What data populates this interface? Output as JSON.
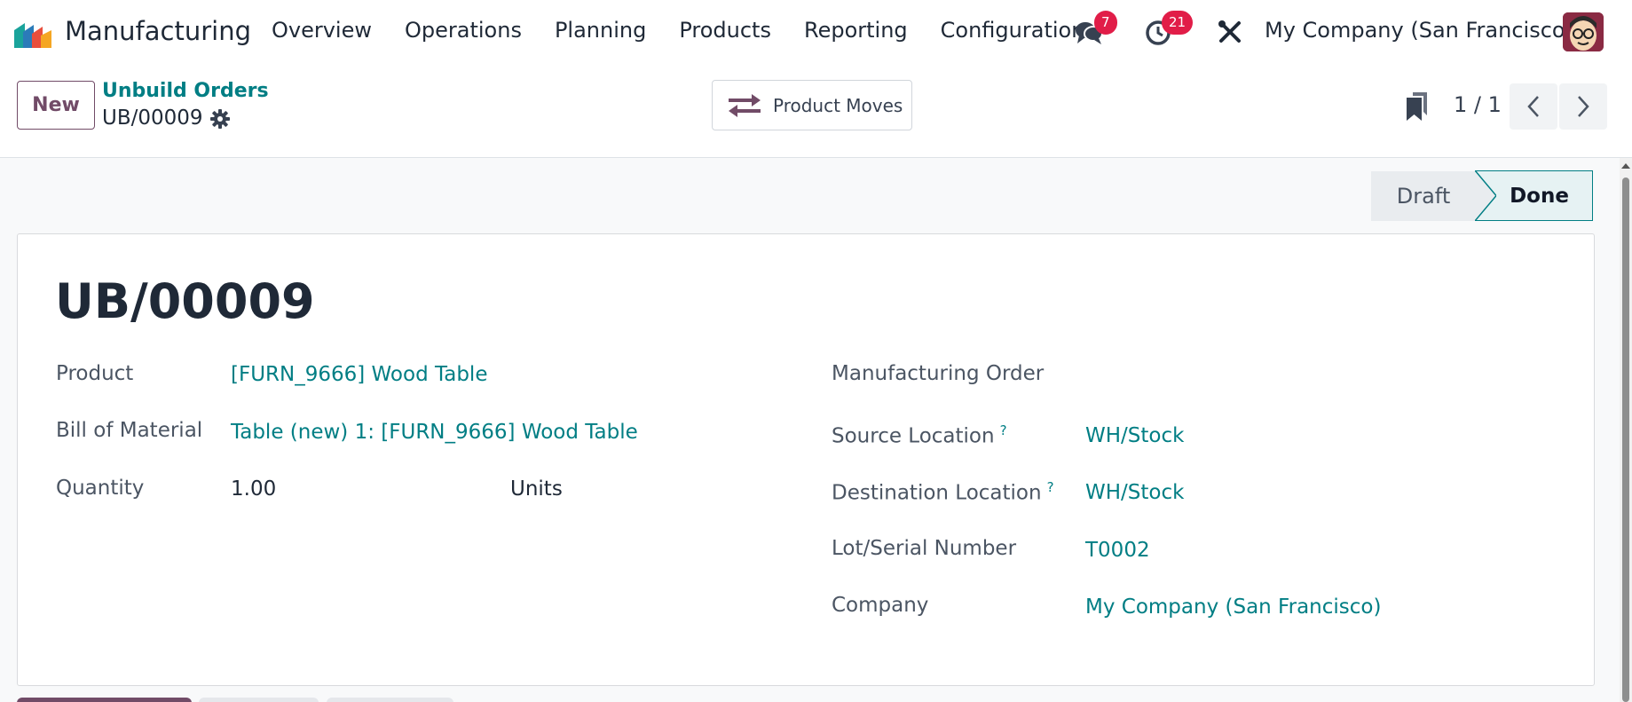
{
  "navbar": {
    "app_name": "Manufacturing",
    "menu": [
      "Overview",
      "Operations",
      "Planning",
      "Products",
      "Reporting",
      "Configuration"
    ],
    "messages_badge": "7",
    "activities_badge": "21",
    "company": "My Company (San Francisco)"
  },
  "control_panel": {
    "new_label": "New",
    "breadcrumb_parent": "Unbuild Orders",
    "breadcrumb_current": "UB/00009",
    "smart_button_label": "Product Moves",
    "pager_value": "1 / 1"
  },
  "statusbar": {
    "stages": [
      "Draft",
      "Done"
    ],
    "current": "Done"
  },
  "record": {
    "title": "UB/00009",
    "left_fields": {
      "product_label": "Product",
      "product_value": "[FURN_9666] Wood Table",
      "bom_label": "Bill of Material",
      "bom_value": "Table (new) 1: [FURN_9666] Wood Table",
      "quantity_label": "Quantity",
      "quantity_value": "1.00",
      "uom_value": "Units"
    },
    "right_fields": {
      "mo_label": "Manufacturing Order",
      "source_label": "Source Location",
      "source_value": "WH/Stock",
      "dest_label": "Destination Location",
      "dest_value": "WH/Stock",
      "lot_label": "Lot/Serial Number",
      "lot_value": "T0002",
      "company_label": "Company",
      "company_value": "My Company (San Francisco)"
    },
    "tooltip_mark": "?"
  },
  "colors": {
    "brand": "#714B67",
    "link": "#017e84",
    "badge": "#e11d48"
  }
}
